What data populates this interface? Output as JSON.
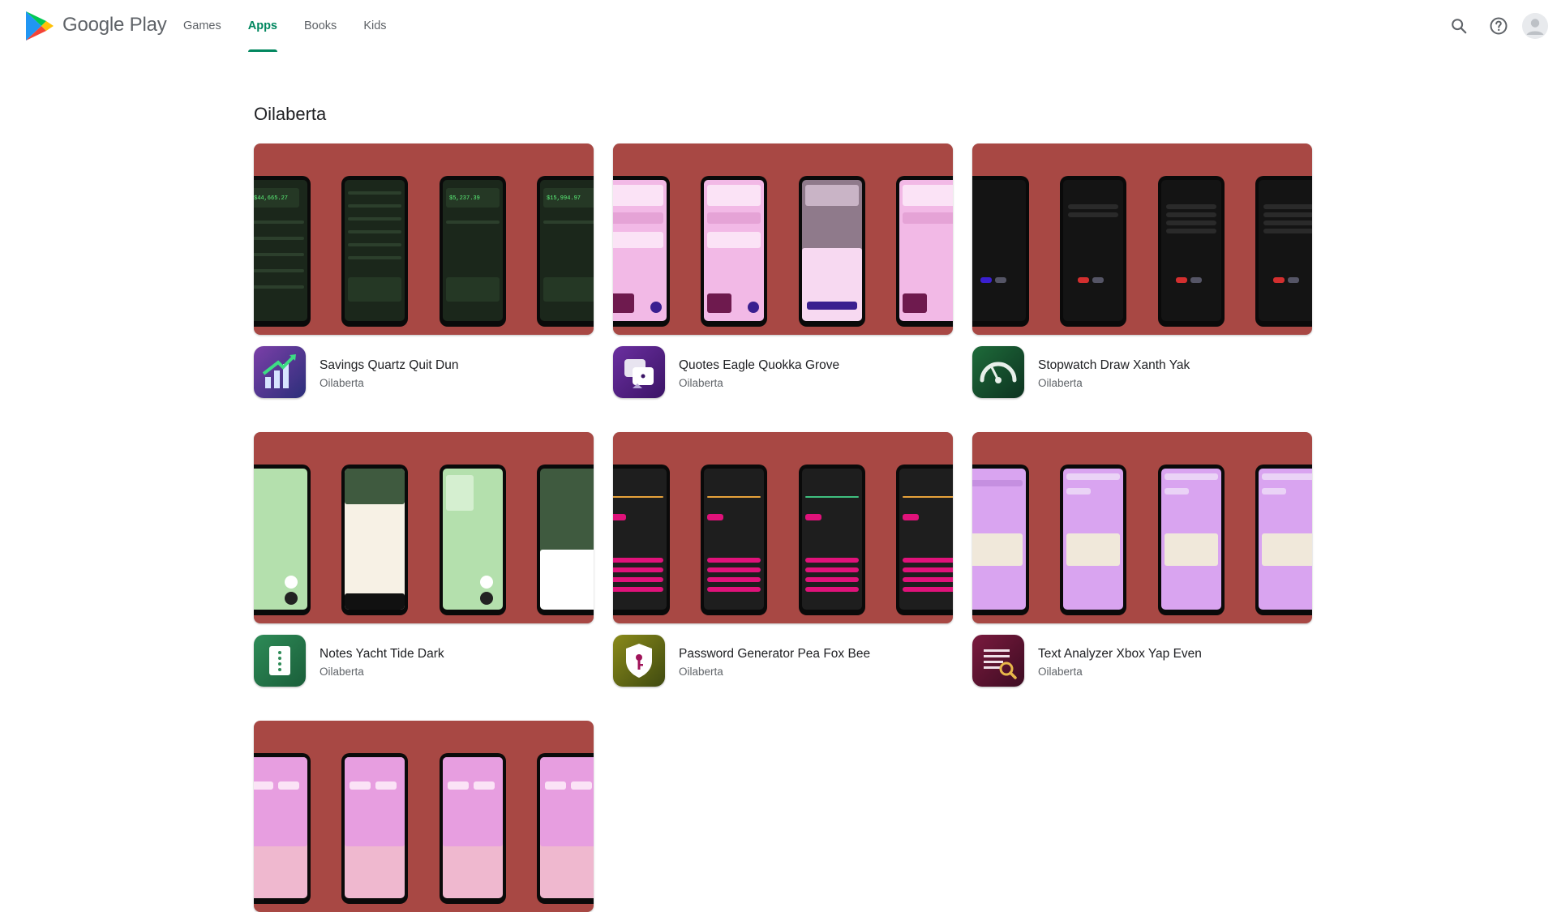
{
  "header": {
    "brand": "Google Play",
    "nav": [
      {
        "label": "Games",
        "active": false
      },
      {
        "label": "Apps",
        "active": true
      },
      {
        "label": "Books",
        "active": false
      },
      {
        "label": "Kids",
        "active": false
      }
    ],
    "icons": [
      "search-icon",
      "help-icon",
      "account-avatar"
    ],
    "accent_color": "#01875f"
  },
  "developer": {
    "title": "Oilaberta"
  },
  "apps": [
    {
      "name": "Savings Quartz Quit Dun",
      "developer": "Oilaberta",
      "amounts": [
        "$44,665.27",
        "$5,237.39",
        "$15,994.97"
      ]
    },
    {
      "name": "Quotes Eagle Quokka Grove",
      "developer": "Oilaberta"
    },
    {
      "name": "Stopwatch Draw Xanth Yak",
      "developer": "Oilaberta"
    },
    {
      "name": "Notes Yacht Tide Dark",
      "developer": "Oilaberta"
    },
    {
      "name": "Password Generator Pea Fox Bee",
      "developer": "Oilaberta"
    },
    {
      "name": "Text Analyzer Xbox Yap Even",
      "developer": "Oilaberta"
    },
    {
      "name": "",
      "developer": ""
    }
  ],
  "banner_color": "#a84844"
}
